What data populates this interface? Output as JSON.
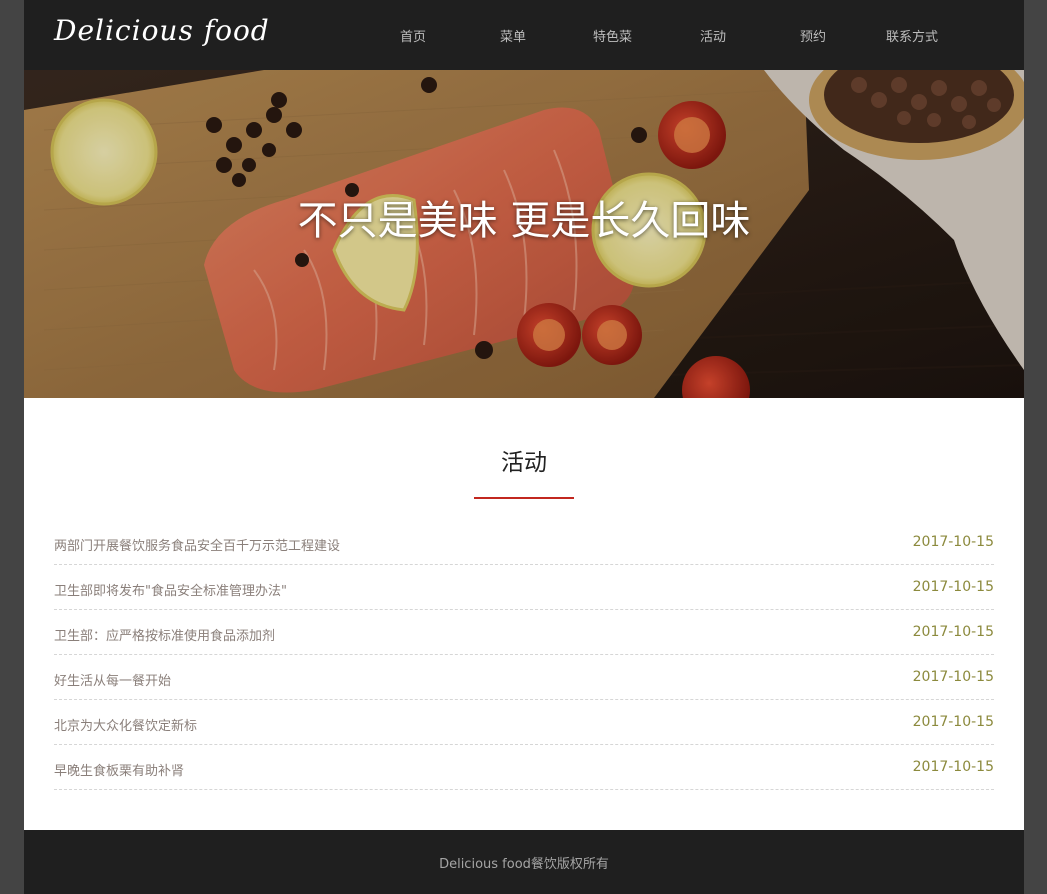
{
  "header": {
    "logo": "Delicious food",
    "nav": [
      {
        "label": "首页"
      },
      {
        "label": "菜单"
      },
      {
        "label": "特色菜"
      },
      {
        "label": "活动"
      },
      {
        "label": "预约"
      },
      {
        "label": "联系方式"
      }
    ]
  },
  "hero": {
    "slogan": "不只是美味 更是长久回味"
  },
  "activity": {
    "title": "活动",
    "items": [
      {
        "title": "两部门开展餐饮服务食品安全百千万示范工程建设",
        "date": "2017-10-15"
      },
      {
        "title": "卫生部即将发布\"食品安全标准管理办法\"",
        "date": "2017-10-15"
      },
      {
        "title": "卫生部：应严格按标准使用食品添加剂",
        "date": "2017-10-15"
      },
      {
        "title": "好生活从每一餐开始",
        "date": "2017-10-15"
      },
      {
        "title": "北京为大众化餐饮定新标",
        "date": "2017-10-15"
      },
      {
        "title": "早晚生食板栗有助补肾",
        "date": "2017-10-15"
      }
    ]
  },
  "footer": {
    "copyright": "Delicious food餐饮版权所有"
  },
  "colors": {
    "header_bg": "#1f1f1f",
    "accent_underline": "#c2271f",
    "date_color": "#8c8a3d",
    "news_text": "#8a7f7a"
  }
}
